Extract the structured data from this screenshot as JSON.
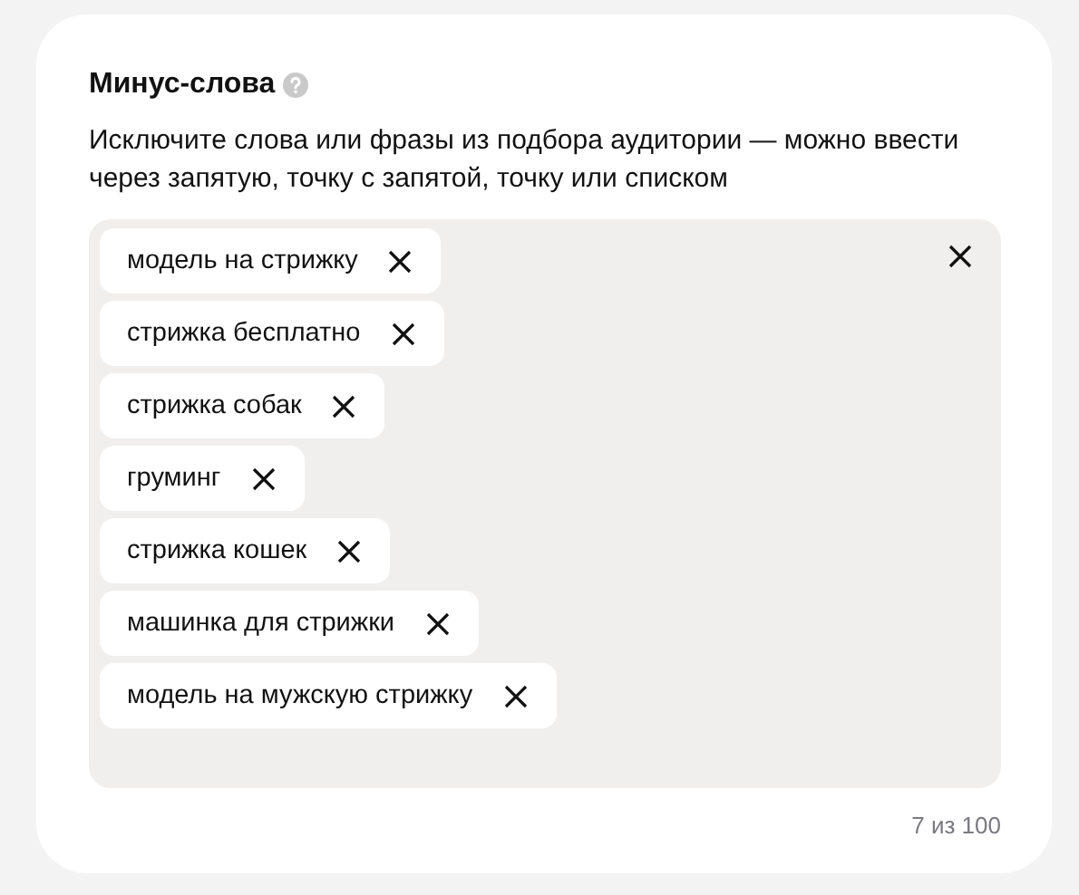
{
  "title": "Минус-слова",
  "description": "Исключите слова или фразы из подбора аудитории — можно ввести через запятую, точку с запятой, точку или списком",
  "chips": [
    {
      "label": "модель на стрижку"
    },
    {
      "label": "стрижка бесплатно"
    },
    {
      "label": "стрижка собак"
    },
    {
      "label": "груминг"
    },
    {
      "label": "стрижка кошек"
    },
    {
      "label": "машинка для стрижки"
    },
    {
      "label": "модель на мужскую стрижку"
    }
  ],
  "counter": "7 из 100"
}
